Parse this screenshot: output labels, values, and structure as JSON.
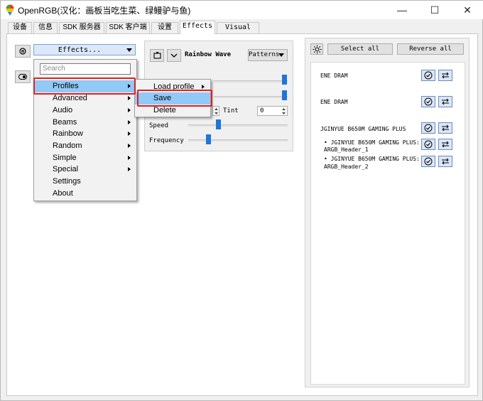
{
  "window": {
    "title": "OpenRGB(汉化：画板当吃生菜、绿鳗驴与鱼)",
    "minimize_glyph": "—",
    "maximize_glyph": "☐",
    "close_glyph": "✕"
  },
  "tabs": [
    {
      "label": "设备"
    },
    {
      "label": "信息"
    },
    {
      "label": "SDK 服务器"
    },
    {
      "label": "SDK 客户端"
    },
    {
      "label": "设置"
    },
    {
      "label": "Effects"
    },
    {
      "label": "Visual Map"
    }
  ],
  "effects_panel": {
    "effects_dropdown": "Effects...",
    "search_placeholder": "Search",
    "effect_name": "Rainbow Wave",
    "patterns_dropdown": "Patterns",
    "tint_label": "Tint",
    "tint_value": "0",
    "speed_label": "Speed",
    "speed_level": 0.29,
    "frequency_label": "Frequency",
    "frequency_level": 0.19
  },
  "effects_menu": {
    "items": [
      {
        "label": "Profiles",
        "submenu": true
      },
      {
        "label": "Advanced",
        "submenu": true
      },
      {
        "label": "Audio",
        "submenu": true
      },
      {
        "label": "Beams",
        "submenu": true
      },
      {
        "label": "Rainbow",
        "submenu": true
      },
      {
        "label": "Random",
        "submenu": true
      },
      {
        "label": "Simple",
        "submenu": true
      },
      {
        "label": "Special",
        "submenu": true
      },
      {
        "label": "Settings",
        "submenu": false
      },
      {
        "label": "About",
        "submenu": false
      }
    ]
  },
  "profiles_submenu": {
    "items": [
      {
        "label": "Load profile",
        "submenu": true
      },
      {
        "label": "Save",
        "submenu": false
      },
      {
        "label": "Delete",
        "submenu": false
      }
    ]
  },
  "devices_panel": {
    "select_all": "Select all",
    "reverse_all": "Reverse all",
    "devices": [
      {
        "name": "ENE DRAM"
      },
      {
        "name": "ENE DRAM"
      },
      {
        "name": "JGINYUE B650M GAMING PLUS"
      },
      {
        "name": "• JGINYUE B650M GAMING PLUS:",
        "name2": "ARGB_Header_1"
      },
      {
        "name": "• JGINYUE B650M GAMING PLUS:",
        "name2": "ARGB_Header_2"
      }
    ]
  },
  "colors": {
    "accent": "#1f77d4",
    "highlight": "#91c9f7",
    "annotation_red": "#e02020"
  }
}
